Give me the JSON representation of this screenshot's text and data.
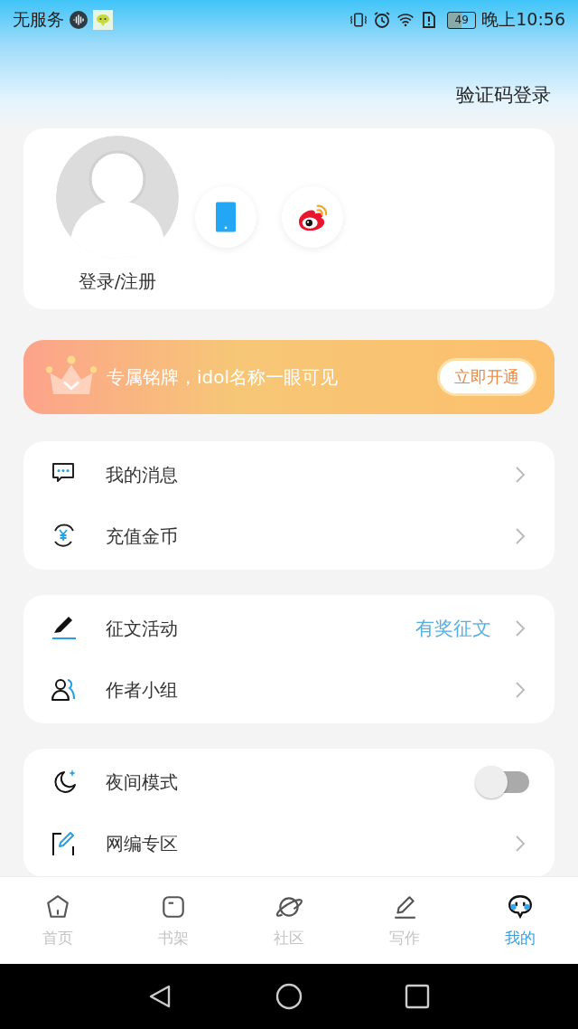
{
  "status_bar": {
    "carrier": "无服务",
    "battery": "49",
    "time": "晚上10:56"
  },
  "header": {
    "link": "验证码登录"
  },
  "profile": {
    "login": "登录/注册"
  },
  "banner": {
    "text": "专属铭牌，idol名称一眼可见",
    "button": "立即开通"
  },
  "menu_groups": [
    {
      "items": [
        {
          "kind": "link",
          "label": "我的消息"
        },
        {
          "kind": "link",
          "label": "充值金币"
        }
      ]
    },
    {
      "items": [
        {
          "kind": "link",
          "label": "征文活动",
          "note": "有奖征文"
        },
        {
          "kind": "link",
          "label": "作者小组"
        }
      ]
    },
    {
      "items": [
        {
          "kind": "toggle",
          "label": "夜间模式",
          "on": false
        },
        {
          "kind": "link",
          "label": "网编专区"
        }
      ]
    }
  ],
  "tabs": [
    {
      "label": "首页",
      "selected": false
    },
    {
      "label": "书架",
      "selected": false
    },
    {
      "label": "社区",
      "selected": false
    },
    {
      "label": "写作",
      "selected": false
    },
    {
      "label": "我的",
      "selected": true
    }
  ]
}
